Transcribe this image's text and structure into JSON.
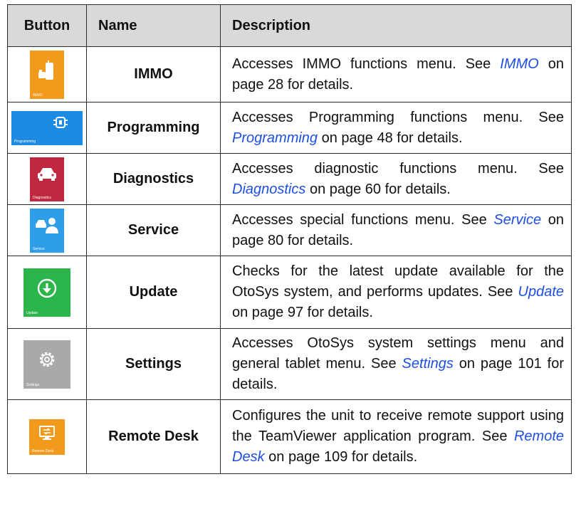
{
  "header": {
    "button": "Button",
    "name": "Name",
    "description": "Description"
  },
  "rows": [
    {
      "icon": "immo-key-icon",
      "color": "#f39a1c",
      "caption": "IMMO",
      "name": "IMMO",
      "pre": "Accesses IMMO functions menu. See ",
      "link": "IMMO",
      "post": " on page 28 for details."
    },
    {
      "icon": "programming-chip-icon",
      "color": "#1e8be3",
      "caption": "Programming",
      "name": "Programming",
      "pre": "Accesses Programming functions menu. See ",
      "link": "Programming",
      "post": " on page 48 for details."
    },
    {
      "icon": "diagnostics-car-icon",
      "color": "#c0283f",
      "caption": "Diagnostics",
      "name": "Diagnostics",
      "pre": "Accesses diagnostic functions menu. See ",
      "link": "Diagnostics",
      "post": " on page 60 for details."
    },
    {
      "icon": "service-mechanic-icon",
      "color": "#2e9ee8",
      "caption": "Service",
      "name": "Service",
      "pre": "Accesses special functions menu. See ",
      "link": "Service",
      "post": " on page 80 for details."
    },
    {
      "icon": "update-download-icon",
      "color": "#2bb54a",
      "caption": "Update",
      "name": "Update",
      "pre": "Checks for the latest update available for the OtoSys system, and performs updates. See ",
      "link": "Update",
      "post": " on page 97 for details."
    },
    {
      "icon": "settings-gear-icon",
      "color": "#a7a9ab",
      "caption": "Settings",
      "name": "Settings",
      "pre": "Accesses OtoSys system settings menu and general tablet menu. See ",
      "link": "Settings",
      "post": " on page 101 for details."
    },
    {
      "icon": "remote-desk-icon",
      "color": "#f39a1c",
      "caption": "Remote Desk",
      "name": "Remote Desk",
      "pre": "Configures the unit to receive remote support using the TeamViewer application program. See ",
      "link": "Remote Desk",
      "post": " on page 109 for details."
    }
  ]
}
